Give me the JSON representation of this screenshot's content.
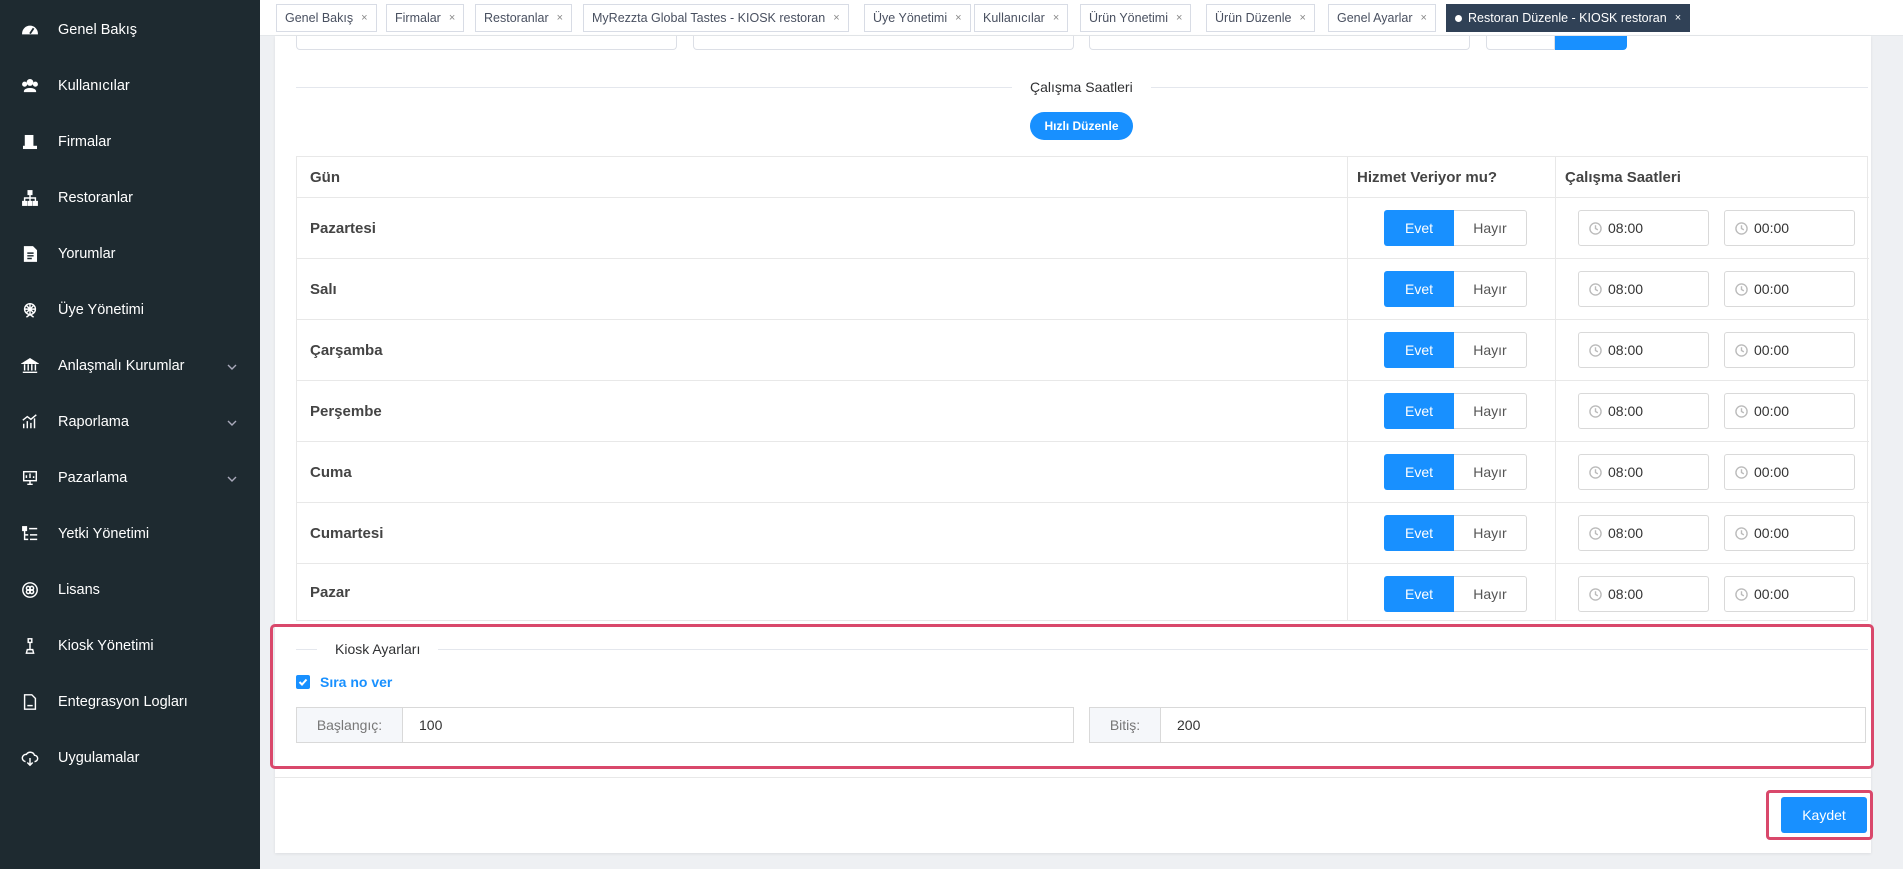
{
  "sidebar": {
    "items": [
      {
        "label": "Genel Bakış",
        "icon": "dashboard-icon"
      },
      {
        "label": "Kullanıcılar",
        "icon": "users-icon"
      },
      {
        "label": "Firmalar",
        "icon": "building-icon"
      },
      {
        "label": "Restoranlar",
        "icon": "sitemap-icon"
      },
      {
        "label": "Yorumlar",
        "icon": "document-icon"
      },
      {
        "label": "Üye Yönetimi",
        "icon": "wheel-icon"
      },
      {
        "label": "Anlaşmalı Kurumlar",
        "icon": "bank-icon"
      },
      {
        "label": "Raporlama",
        "icon": "chart-icon"
      },
      {
        "label": "Pazarlama",
        "icon": "presentation-icon"
      },
      {
        "label": "Yetki Yönetimi",
        "icon": "list-tree-icon"
      },
      {
        "label": "Lisans",
        "icon": "license-icon"
      },
      {
        "label": "Kiosk Yönetimi",
        "icon": "kiosk-icon"
      },
      {
        "label": "Entegrasyon Logları",
        "icon": "log-file-icon"
      },
      {
        "label": "Uygulamalar",
        "icon": "cloud-icon"
      }
    ]
  },
  "tabs": [
    {
      "label": "Genel Bakış",
      "close": "×"
    },
    {
      "label": "Firmalar",
      "close": "×"
    },
    {
      "label": "Restoranlar",
      "close": "×"
    },
    {
      "label": "MyRezzta Global Tastes - KIOSK restoran",
      "close": "×"
    },
    {
      "label": "Üye Yönetimi",
      "close": "×"
    },
    {
      "label": "Kullanıcılar",
      "close": "×"
    },
    {
      "label": "Ürün Yönetimi",
      "close": "×"
    },
    {
      "label": "Ürün Düzenle",
      "close": "×"
    },
    {
      "label": "Genel Ayarlar",
      "close": "×"
    },
    {
      "label": "Restoran Düzenle - KIOSK restoran",
      "close": "×"
    }
  ],
  "hours_section": {
    "title": "Çalışma Saatleri",
    "quick_edit": "Hızlı Düzenle",
    "headers": {
      "day": "Gün",
      "serving": "Hizmet Veriyor mu?",
      "hours": "Çalışma Saatleri"
    },
    "yes": "Evet",
    "no": "Hayır",
    "rows": [
      {
        "day": "Pazartesi",
        "open": "08:00",
        "close": "00:00"
      },
      {
        "day": "Salı",
        "open": "08:00",
        "close": "00:00"
      },
      {
        "day": "Çarşamba",
        "open": "08:00",
        "close": "00:00"
      },
      {
        "day": "Perşembe",
        "open": "08:00",
        "close": "00:00"
      },
      {
        "day": "Cuma",
        "open": "08:00",
        "close": "00:00"
      },
      {
        "day": "Cumartesi",
        "open": "08:00",
        "close": "00:00"
      },
      {
        "day": "Pazar",
        "open": "08:00",
        "close": "00:00"
      }
    ]
  },
  "kiosk": {
    "title": "Kiosk Ayarları",
    "checkbox_label": "Sıra no ver",
    "start_label": "Başlangıç:",
    "start_value": "100",
    "end_label": "Bitiş:",
    "end_value": "200"
  },
  "save_label": "Kaydet",
  "colors": {
    "primary": "#1890ff",
    "sidebar": "#1e2a30",
    "highlight": "#d9486b",
    "active_tab": "#304156"
  }
}
